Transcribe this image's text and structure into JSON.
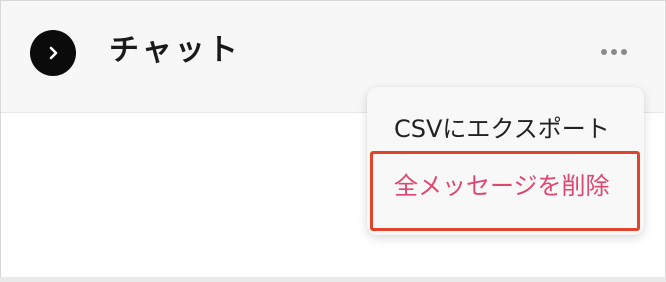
{
  "header": {
    "title": "チャット",
    "collapse_icon": "chevron-right-icon",
    "more_icon": "ellipsis-icon"
  },
  "menu": {
    "items": [
      {
        "label": "CSVにエクスポート"
      },
      {
        "label": "全メッセージを削除"
      }
    ]
  },
  "colors": {
    "delete_text": "#e0466e",
    "highlight_border": "#e2442b",
    "collapse_button_bg": "#0b0b0b"
  }
}
